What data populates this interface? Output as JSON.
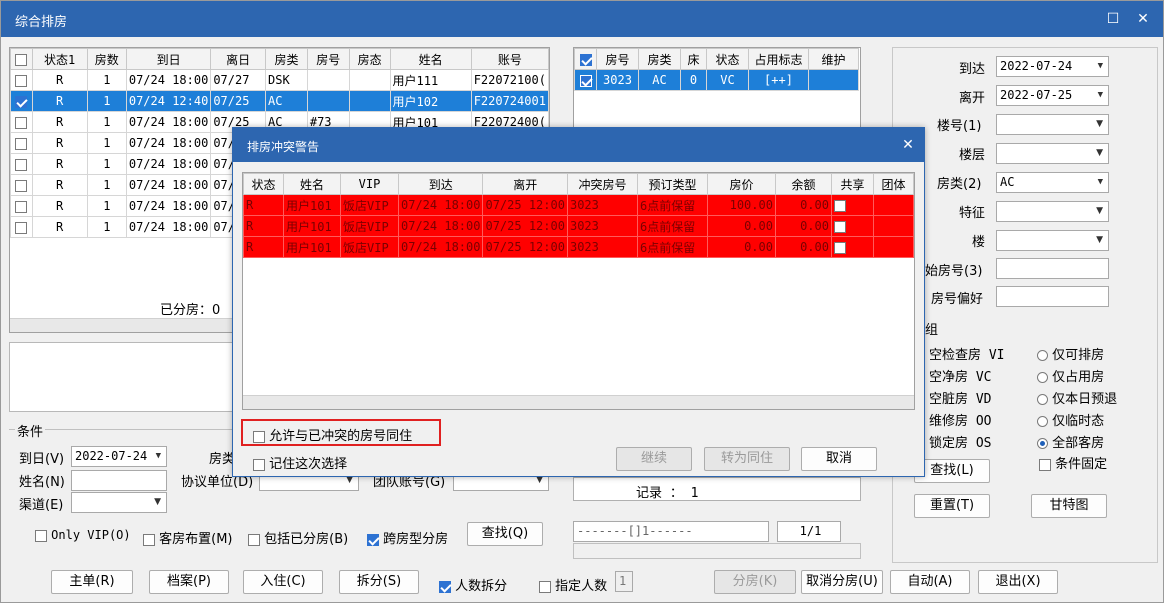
{
  "window": {
    "title": "综合排房"
  },
  "left_grid": {
    "headers": [
      "状态1",
      "房数",
      "到日",
      "离日",
      "房类",
      "房号",
      "房态",
      "姓名",
      "账号"
    ],
    "rows": [
      {
        "checked": false,
        "selected": false,
        "cells": [
          "R",
          "1",
          "07/24 18:00",
          "07/27",
          "DSK",
          "",
          "",
          "用户111",
          "F22072100("
        ]
      },
      {
        "checked": true,
        "selected": true,
        "cells": [
          "R",
          "1",
          "07/24 12:40",
          "07/25",
          "AC",
          "",
          "",
          "用户102",
          "F220724001"
        ]
      },
      {
        "checked": false,
        "selected": false,
        "cells": [
          "R",
          "1",
          "07/24 18:00",
          "07/25",
          "AC",
          "#73",
          "",
          "用户101",
          "F22072400("
        ]
      },
      {
        "checked": false,
        "selected": false,
        "cells": [
          "R",
          "1",
          "07/24 18:00",
          "07/",
          "",
          "",
          "",
          "",
          ""
        ]
      },
      {
        "checked": false,
        "selected": false,
        "cells": [
          "R",
          "1",
          "07/24 18:00",
          "07/",
          "",
          "",
          "",
          "",
          ""
        ]
      },
      {
        "checked": false,
        "selected": false,
        "cells": [
          "R",
          "1",
          "07/24 18:00",
          "07/",
          "",
          "",
          "",
          "",
          ""
        ]
      },
      {
        "checked": false,
        "selected": false,
        "cells": [
          "R",
          "1",
          "07/24 18:00",
          "07/",
          "",
          "",
          "",
          "",
          ""
        ]
      },
      {
        "checked": false,
        "selected": false,
        "cells": [
          "R",
          "1",
          "07/24 18:00",
          "07/",
          "",
          "",
          "",
          "",
          ""
        ]
      }
    ],
    "footer": "已分房：0"
  },
  "room_grid": {
    "headers": [
      "房号",
      "房类",
      "床",
      "状态",
      "占用标志",
      "维护"
    ],
    "rows": [
      {
        "checked": true,
        "cells": [
          "3023",
          "AC",
          "0",
          "VC",
          "[++]",
          ""
        ]
      }
    ],
    "record_label": "记录 ： 1",
    "pager_text": "-------[]1------",
    "page_num": "1/1"
  },
  "right_panel": {
    "arrive_label": "到达",
    "arrive_value": "2022-07-24",
    "depart_label": "离开",
    "depart_value": "2022-07-25",
    "building_label": "楼号(1)",
    "floor_label": "楼层",
    "roomtype_label": "房类(2)",
    "roomtype_value": "AC",
    "feature_label": "特征",
    "tower_label": "楼",
    "start_room_label": "始房号(3)",
    "pref_label": "房号偏好",
    "group_label": "组",
    "status_options": [
      "空检查房 VI",
      "空净房 VC",
      "空脏房 VD",
      "维修房 OO",
      "锁定房 OS"
    ],
    "radio_options": [
      {
        "label": "仅可排房",
        "on": false
      },
      {
        "label": "仅占用房",
        "on": false
      },
      {
        "label": "仅本日预退",
        "on": false
      },
      {
        "label": "仅临时态",
        "on": false
      },
      {
        "label": "全部客房",
        "on": true
      }
    ],
    "fix_cond_label": "条件固定",
    "search_label": "查找(L)",
    "reset_label": "重置(T)",
    "gantt_label": "甘特图"
  },
  "conditions": {
    "group_label": "条件",
    "arrive_label": "到日(V)",
    "arrive_value": "2022-07-24",
    "roomtype_label": "房类",
    "name_label": "姓名(N)",
    "agreement_label": "协议单位(D)",
    "team_label": "团队账号(G)",
    "channel_label": "渠道(E)",
    "only_vip_label": "Only VIP(O)",
    "layout_label": "客房布置(M)",
    "include_assigned_label": "包括已分房(B)",
    "cross_type_label": "跨房型分房",
    "find_label": "查找(Q)"
  },
  "bottom_bar": {
    "main_order": "主单(R)",
    "profile": "档案(P)",
    "checkin": "入住(C)",
    "split": "拆分(S)",
    "split_by_people": "人数拆分",
    "set_people": "指定人数",
    "people_count": "1",
    "assign": "分房(K)",
    "cancel_assign": "取消分房(U)",
    "auto": "自动(A)",
    "exit": "退出(X)"
  },
  "dialog": {
    "title": "排房冲突警告",
    "headers": [
      "状态",
      "姓名",
      "VIP",
      "到达",
      "离开",
      "冲突房号",
      "预订类型",
      "房价",
      "余额",
      "共享",
      "团体"
    ],
    "rows": [
      [
        "R",
        "用户101",
        "饭店VIP",
        "07/24 18:00",
        "07/25 12:00",
        "3023",
        "6点前保留",
        "100.00",
        "0.00"
      ],
      [
        "R",
        "用户101",
        "饭店VIP",
        "07/24 18:00",
        "07/25 12:00",
        "3023",
        "6点前保留",
        "0.00",
        "0.00"
      ],
      [
        "R",
        "用户101",
        "饭店VIP",
        "07/24 18:00",
        "07/25 12:00",
        "3023",
        "6点前保留",
        "0.00",
        "0.00"
      ]
    ],
    "allow_share_label": "允许与已冲突的房号同住",
    "remember_label": "记住这次选择",
    "continue_label": "继续",
    "to_share_label": "转为同住",
    "cancel_label": "取消"
  },
  "colors": {
    "accent": "#2d66b0",
    "selected_row": "#1e7fd8",
    "conflict_row": "#ff0000",
    "highlight_box": "#e02020"
  }
}
